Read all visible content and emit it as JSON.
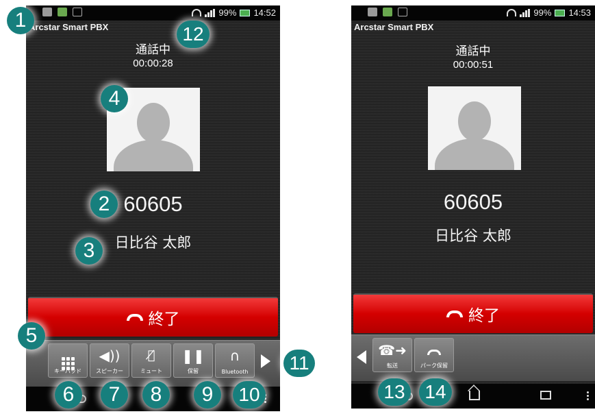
{
  "left_screen": {
    "status_bar": {
      "battery_text": "99%",
      "time": "14:52"
    },
    "app_title": "Arcstar Smart PBX",
    "call_status": "通話中",
    "call_timer": "00:00:28",
    "callee_number": "60605",
    "callee_name": "日比谷 太郎",
    "end_button_label": "終了",
    "toolbar": [
      {
        "label": "キーパッド",
        "icon": "keypad-icon"
      },
      {
        "label": "スピーカー",
        "icon": "speaker-icon"
      },
      {
        "label": "ミュート",
        "icon": "mute-icon"
      },
      {
        "label": "保留",
        "icon": "pause-icon"
      },
      {
        "label": "Bluetooth",
        "icon": "headphones-icon"
      }
    ]
  },
  "right_screen": {
    "status_bar": {
      "battery_text": "99%",
      "time": "14:53"
    },
    "app_title": "Arcstar Smart PBX",
    "call_status": "通話中",
    "call_timer": "00:00:51",
    "callee_number": "60605",
    "callee_name": "日比谷 太郎",
    "end_button_label": "終了",
    "toolbar": [
      {
        "label": "転送",
        "icon": "transfer-icon"
      },
      {
        "label": "パーク保留",
        "icon": "park-hold-icon"
      }
    ]
  },
  "callouts": [
    "1",
    "2",
    "3",
    "4",
    "5",
    "6",
    "7",
    "8",
    "9",
    "10",
    "11",
    "12",
    "13",
    "14"
  ],
  "colors": {
    "end_button": "#d40000",
    "callout_badge": "#177f7d"
  }
}
